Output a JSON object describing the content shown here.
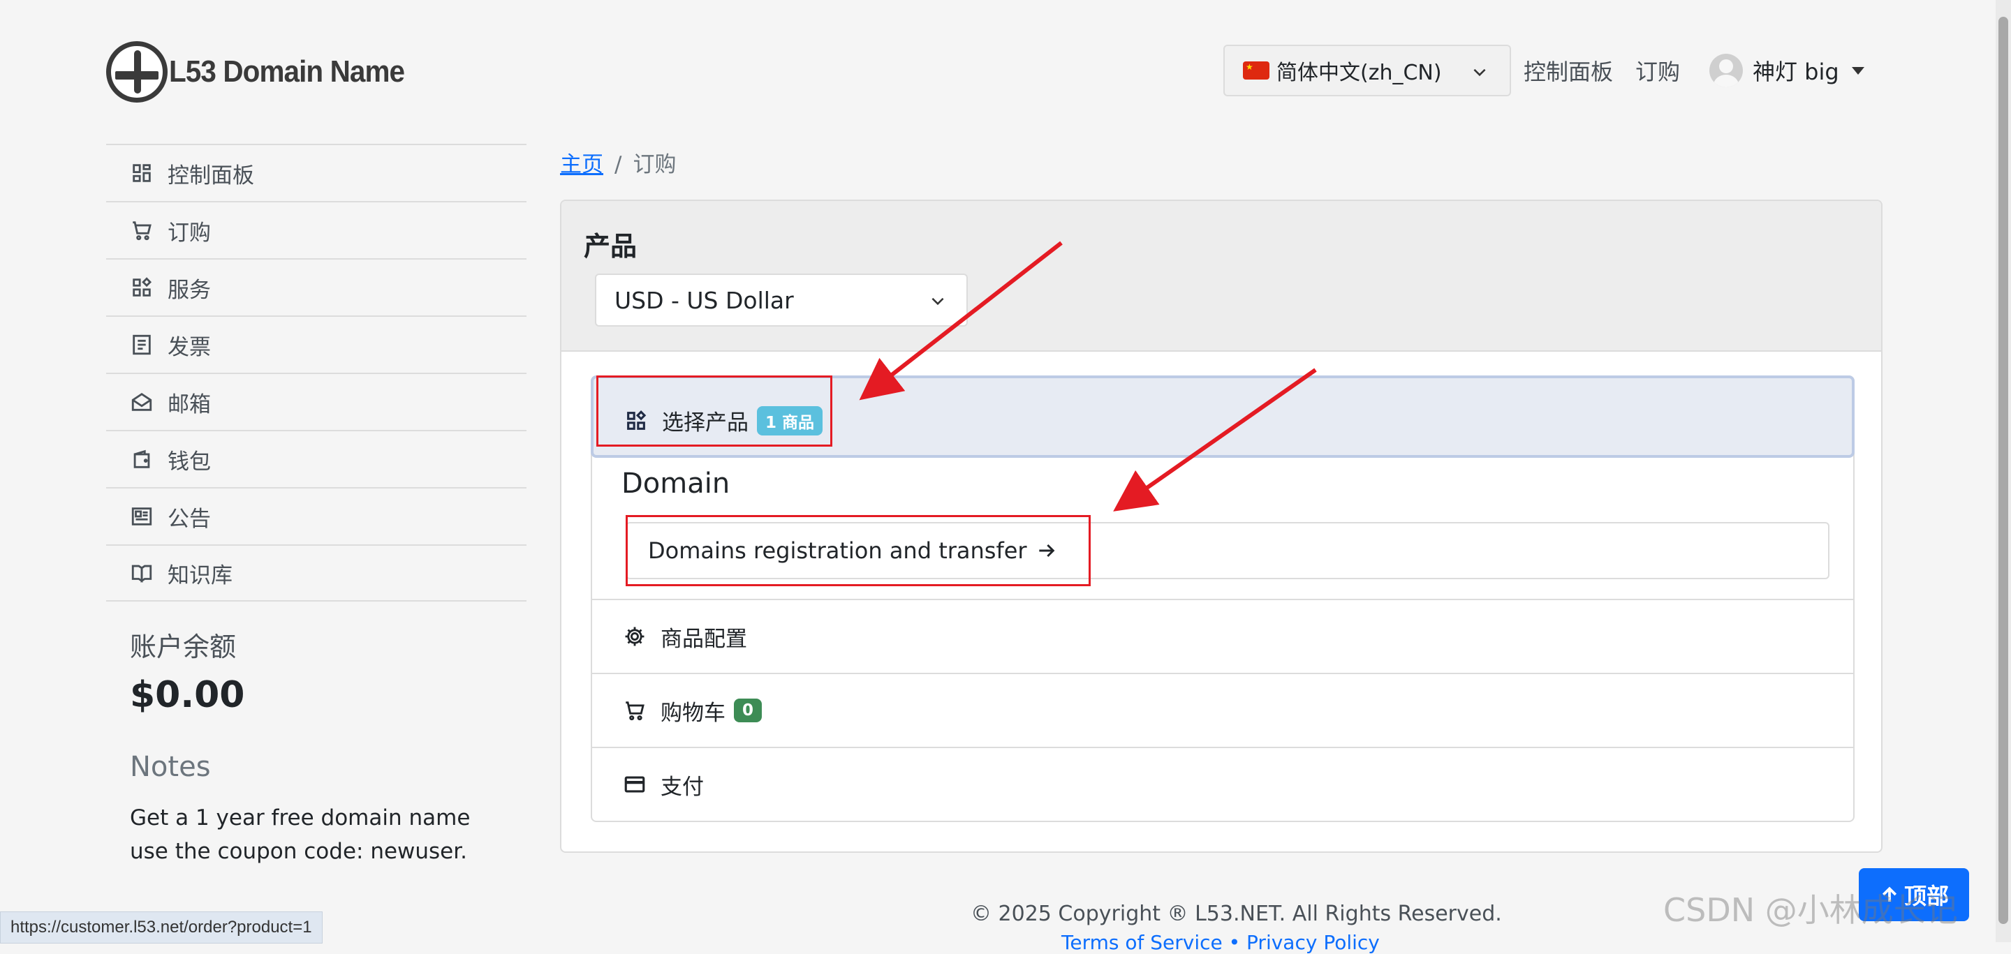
{
  "header": {
    "logo_text": "L53 Domain Name",
    "language": "简体中文(zh_CN)",
    "nav_dashboard": "控制面板",
    "nav_order": "订购",
    "user_name": "神灯 big"
  },
  "sidebar": {
    "items": [
      {
        "label": "控制面板",
        "icon": "dashboard-icon"
      },
      {
        "label": "订购",
        "icon": "cart-icon"
      },
      {
        "label": "服务",
        "icon": "apps-icon"
      },
      {
        "label": "发票",
        "icon": "invoice-icon"
      },
      {
        "label": "邮箱",
        "icon": "mail-open-icon"
      },
      {
        "label": "钱包",
        "icon": "wallet-icon"
      },
      {
        "label": "公告",
        "icon": "news-icon"
      },
      {
        "label": "知识库",
        "icon": "book-icon"
      }
    ],
    "balance_title": "账户余额",
    "balance_value": "$0.00",
    "notes_title": "Notes",
    "notes_text": "Get a 1 year free domain name use the coupon code: newuser."
  },
  "breadcrumb": {
    "home": "主页",
    "separator": "/",
    "current": "订购"
  },
  "main": {
    "card_title": "产品",
    "currency": "USD - US Dollar",
    "steps": {
      "select_product": "选择产品",
      "select_product_badge": "1 商品",
      "section_title": "Domain",
      "domain_link": "Domains registration and transfer",
      "config": "商品配置",
      "cart": "购物车",
      "cart_count": "0",
      "pay": "支付"
    }
  },
  "footer": {
    "copyright": "© 2025 Copyright ® L53.NET. All Rights Reserved.",
    "links": "Terms of Service • Privacy Policy"
  },
  "status_url": "https://customer.l53.net/order?product=1",
  "back_to_top": "顶部",
  "watermark": "CSDN @小林成长记",
  "colors": {
    "primary": "#0d6efd",
    "badge_info": "#5bc0de",
    "badge_success": "#3d8c55",
    "annotation_red": "#e41b23"
  }
}
